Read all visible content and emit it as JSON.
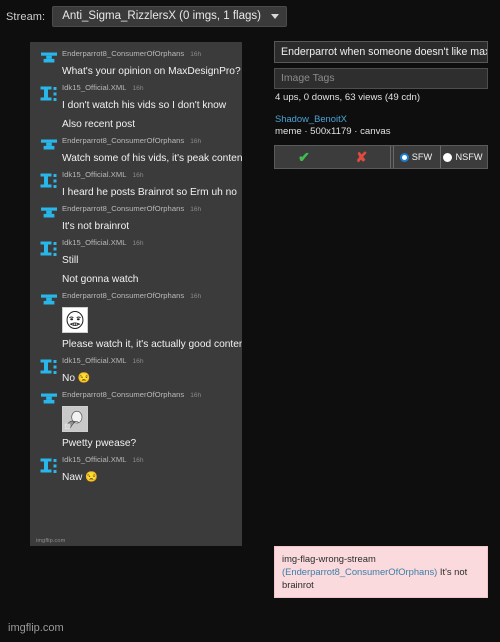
{
  "stream_bar": {
    "label": "Stream:",
    "selected": "Anti_Sigma_RizzlersX (0 imgs, 1 flags)",
    "caret_icon": "chevron-down-icon"
  },
  "chat": {
    "watermark": "imgflip.com",
    "messages": [
      {
        "avatar": "anvil-avatar",
        "author": "Enderparrot8_ConsumerOfOrphans",
        "stamp": "16h",
        "text": "What's your opinion on MaxDesignPro?",
        "image": null,
        "continuation": false
      },
      {
        "avatar": "letter-i-avatar",
        "author": "Idk15_Official.XML",
        "stamp": "16h",
        "text": "I don't watch his vids so I don't know",
        "image": null,
        "continuation": false
      },
      {
        "avatar": null,
        "author": null,
        "stamp": null,
        "text": "Also recent post",
        "image": null,
        "continuation": true
      },
      {
        "avatar": "anvil-avatar",
        "author": "Enderparrot8_ConsumerOfOrphans",
        "stamp": "16h",
        "text": "Watch some of his vids, it's peak content",
        "image": null,
        "continuation": false
      },
      {
        "avatar": "letter-i-avatar",
        "author": "Idk15_Official.XML",
        "stamp": "16h",
        "text": "I heard he posts Brainrot so Erm uh no",
        "image": null,
        "continuation": false
      },
      {
        "avatar": "anvil-avatar",
        "author": "Enderparrot8_ConsumerOfOrphans",
        "stamp": "16h",
        "text": "It's not brainrot",
        "image": null,
        "continuation": false
      },
      {
        "avatar": "letter-i-avatar",
        "author": "Idk15_Official.XML",
        "stamp": "16h",
        "text": "Still",
        "image": null,
        "continuation": false
      },
      {
        "avatar": null,
        "author": null,
        "stamp": null,
        "text": "Not gonna watch",
        "image": null,
        "continuation": true
      },
      {
        "avatar": "anvil-avatar",
        "author": "Enderparrot8_ConsumerOfOrphans",
        "stamp": "16h",
        "text": "Please watch it, it's actually good content",
        "image": "crying-face-meme-thumbnail",
        "continuation": false
      },
      {
        "avatar": "letter-i-avatar",
        "author": "Idk15_Official.XML",
        "stamp": "16h",
        "text": "No 😒",
        "image": null,
        "continuation": false
      },
      {
        "avatar": "anvil-avatar",
        "author": "Enderparrot8_ConsumerOfOrphans",
        "stamp": "16h",
        "text": "Pwetty pwease?",
        "image": "begging-meme-thumbnail",
        "continuation": false
      },
      {
        "avatar": "letter-i-avatar",
        "author": "Idk15_Official.XML",
        "stamp": "16h",
        "text": "Naw 😒",
        "image": null,
        "continuation": false
      }
    ]
  },
  "form": {
    "title_value": "Enderparrot when someone doesn't like max d",
    "tags_placeholder": "Image Tags"
  },
  "meta": {
    "stats": "4 ups, 0 downs, 63 views (49 cdn)",
    "author": "Shadow_BenoitX",
    "sub": "meme · 500x1179 · canvas"
  },
  "actions": {
    "approve_icon": "✔",
    "reject_icon": "✘",
    "sfw_label": "SFW",
    "nsfw_label": "NSFW",
    "selected_rating": "SFW",
    "accent_selected": "#1a7fd4"
  },
  "flag_toast": {
    "type": "img-flag-wrong-stream",
    "reporter": "(Enderparrot8_ConsumerOfOrphans)",
    "reason": "It's not brainrot"
  },
  "page_watermark": "imgflip.com"
}
